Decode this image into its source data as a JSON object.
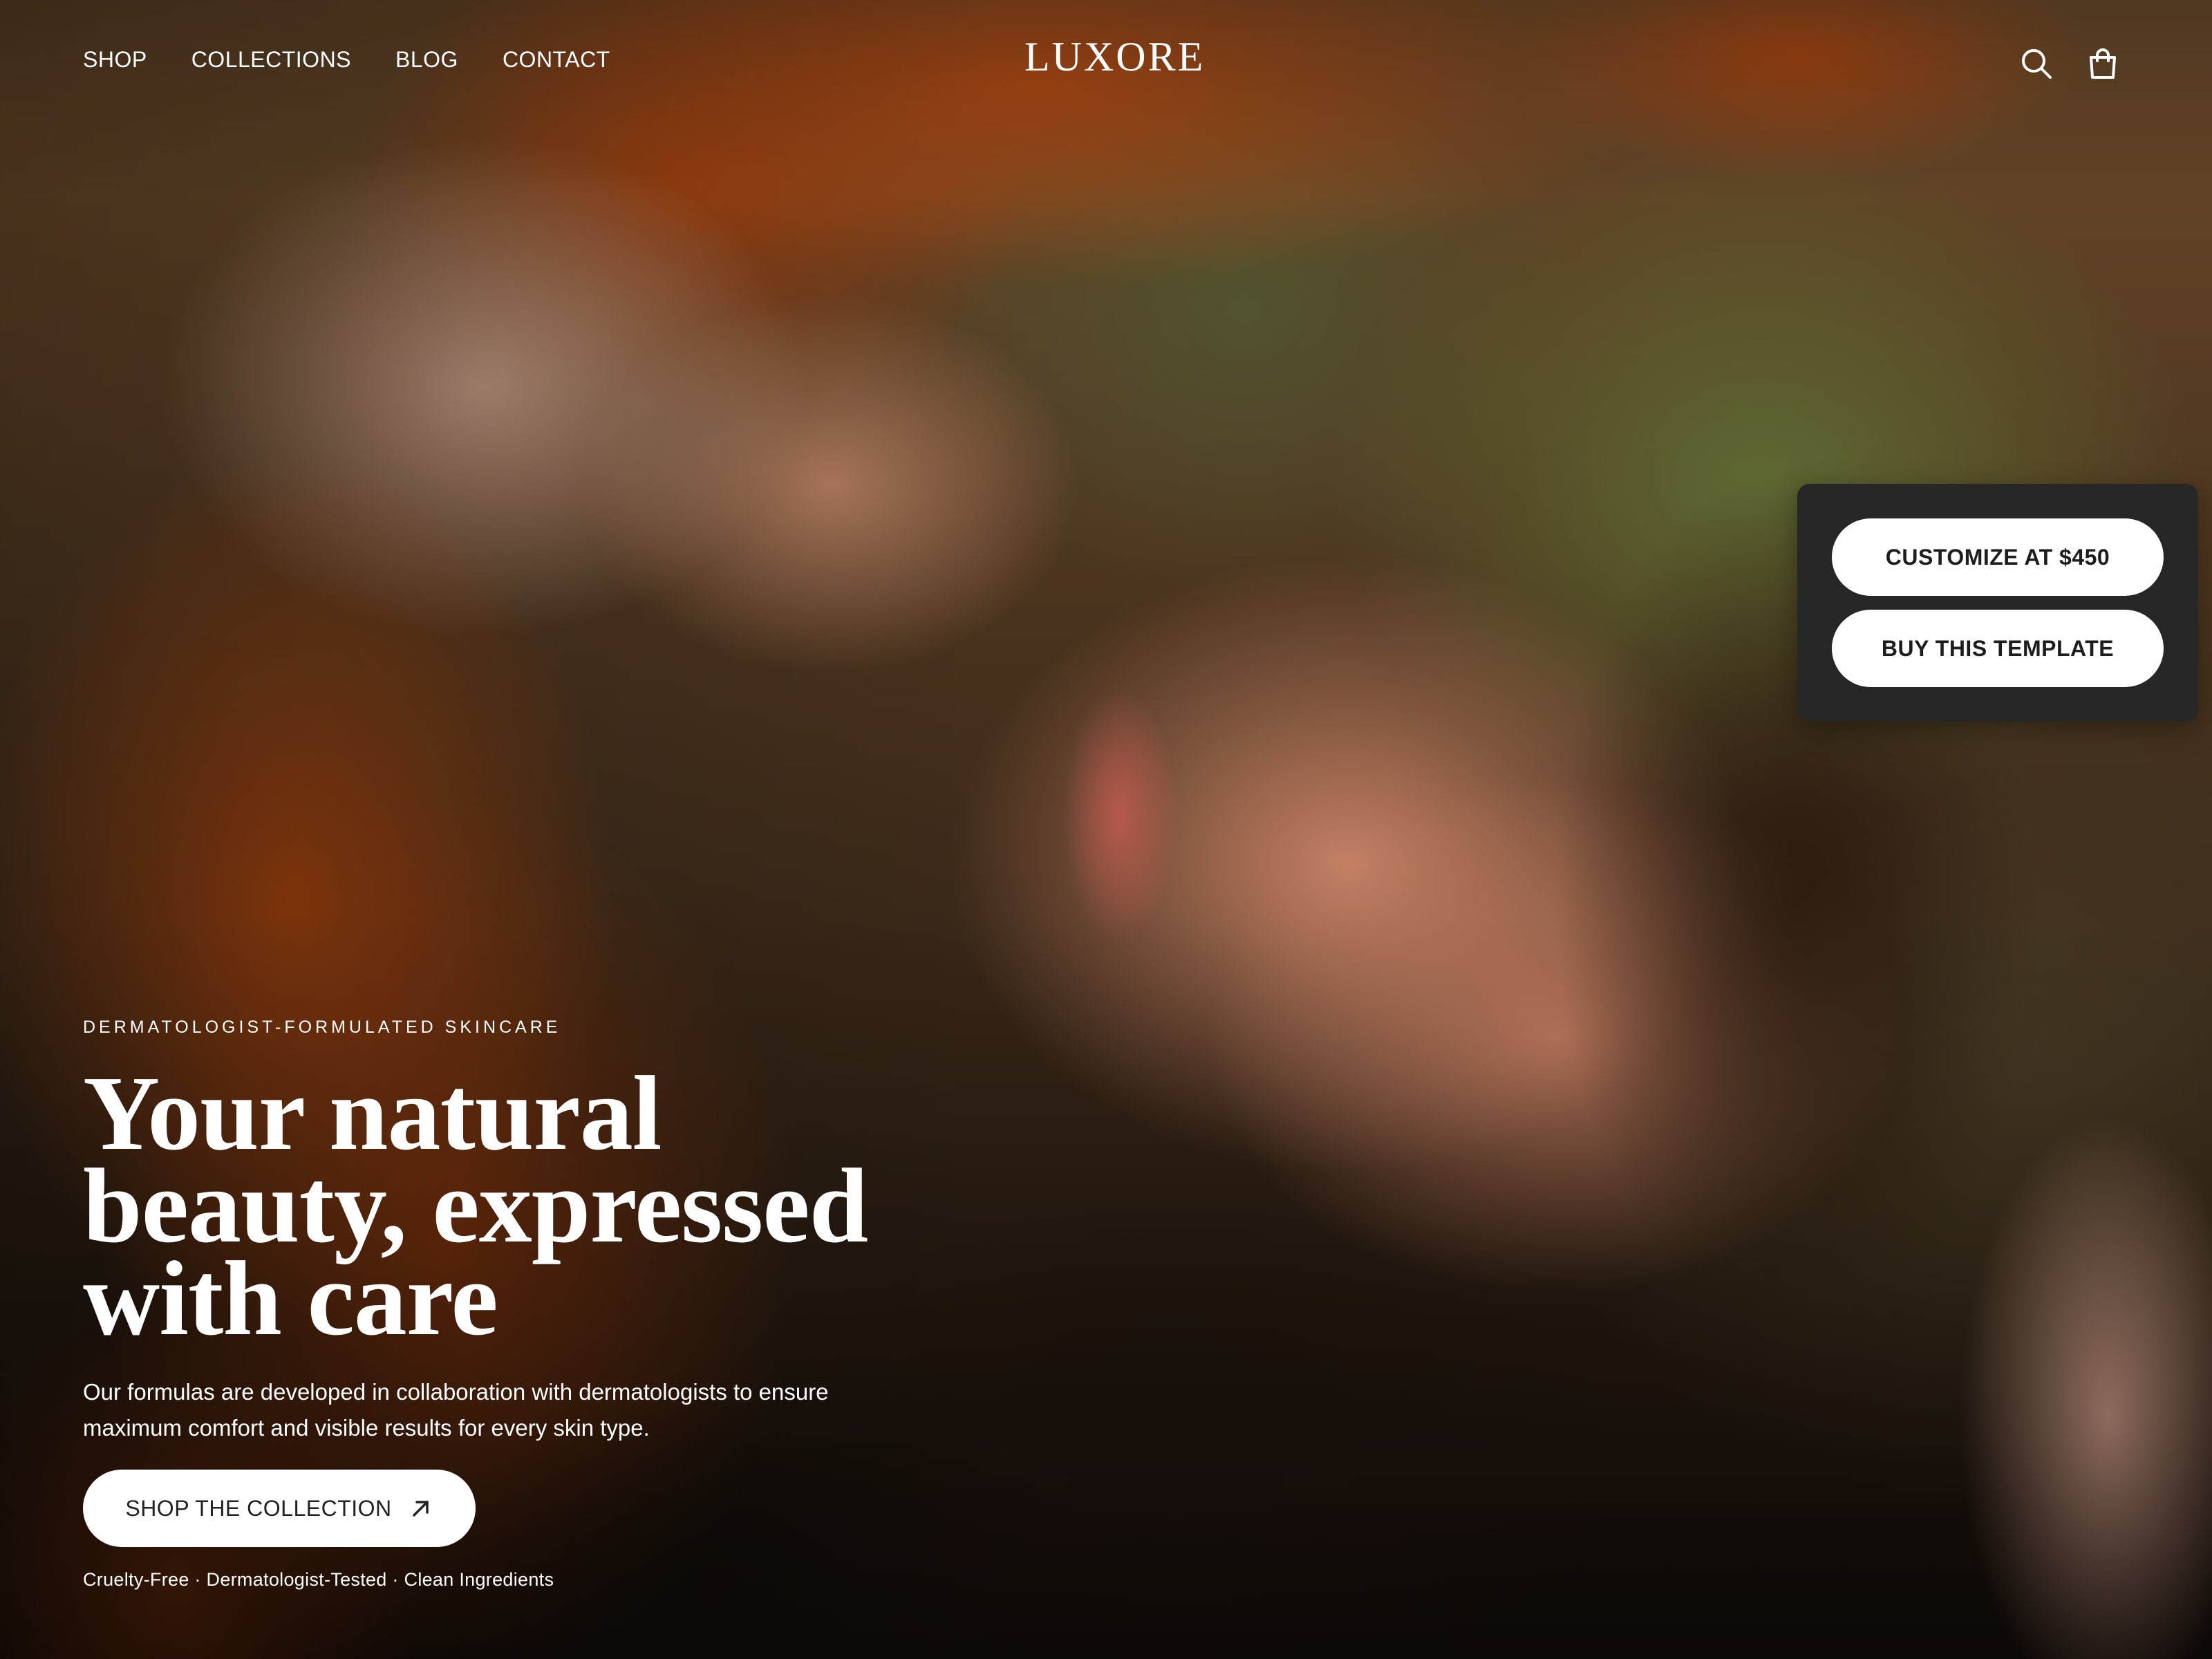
{
  "header": {
    "nav": [
      {
        "label": "SHOP"
      },
      {
        "label": "COLLECTIONS"
      },
      {
        "label": "BLOG"
      },
      {
        "label": "CONTACT"
      }
    ],
    "logo": "LUXORE",
    "icons": [
      "search-icon",
      "shopping-bag-icon"
    ]
  },
  "promo": {
    "customize_label": "CUSTOMIZE AT $450",
    "buy_label": "BUY THIS TEMPLATE"
  },
  "hero": {
    "eyebrow": "DERMATOLOGIST-FORMULATED SKINCARE",
    "headline_lines": [
      "Your natural",
      "beauty, expressed",
      "with care"
    ],
    "subtext_lines": [
      "Our formulas are developed in collaboration with dermatologists to ensure",
      "maximum comfort and visible results for every skin type."
    ],
    "cta_label": "SHOP THE COLLECTION",
    "cta_icon": "arrow-up-right-icon",
    "trust_line": "Cruelty-Free · Dermatologist-Tested · Clean Ingredients"
  },
  "colors": {
    "text": "#ffffff",
    "button_bg": "#ffffff",
    "button_text": "#1d1d1d",
    "panel_bg": "#262626",
    "accent_rust": "#a8481a"
  }
}
